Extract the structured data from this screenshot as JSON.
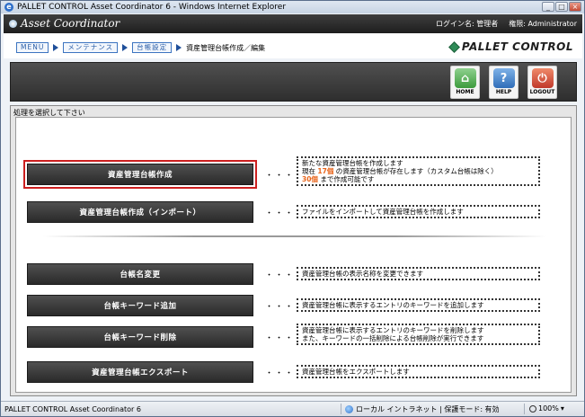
{
  "window": {
    "title": "PALLET CONTROL Asset Coordinator 6 - Windows Internet Explorer",
    "controls": [
      "_",
      "□",
      "×"
    ]
  },
  "header": {
    "app_logo": "Asset Coordinator",
    "login_label": "ログイン名: 管理者",
    "role_label": "権限: Administrator"
  },
  "breadcrumb": {
    "items": [
      "MENU",
      "メンテナンス",
      "台帳設定"
    ],
    "current": "資産管理台帳作成／編集"
  },
  "brand": {
    "logo": "PALLET CONTROL"
  },
  "toolbar": {
    "home": "HOME",
    "help": "HELP",
    "logout": "LOGOUT"
  },
  "panel": {
    "title": "処理を選択して下さい",
    "separator": "・・・",
    "actions": [
      {
        "label": "資産管理台帳作成",
        "desc_line1": "新たな資産管理台帳を作成します",
        "desc_line2_pre": "現在 ",
        "desc_count": "17個",
        "desc_line2_post": " の資産管理台帳が存在します（カスタム台帳は除く）",
        "desc_max": "30個",
        "desc_line3_post": " まで作成可能です"
      },
      {
        "label": "資産管理台帳作成（インポート）",
        "desc": "ファイルをインポートして資産管理台帳を作成します"
      },
      {
        "label": "台帳名変更",
        "desc": "資産管理台帳の表示名称を変更できます"
      },
      {
        "label": "台帳キーワード追加",
        "desc": "資産管理台帳に表示するエントリのキーワードを追加します"
      },
      {
        "label": "台帳キーワード削除",
        "desc_line1": "資産管理台帳に表示するエントリのキーワードを削除します",
        "desc_line2": "また、キーワードの一括削除による台帳削除が実行できます"
      },
      {
        "label": "資産管理台帳エクスポート",
        "desc": "資産管理台帳をエクスポートします"
      }
    ]
  },
  "status": {
    "left": "PALLET CONTROL Asset Coordinator 6",
    "zone": "ローカル イントラネット | 保護モード: 有効",
    "zoom": "100%"
  },
  "colors": {
    "accent_red": "#cc1f1f",
    "highlight_orange": "#e8641a",
    "button_dark": "#3a3a3a",
    "brand_green": "#2e8b57"
  }
}
